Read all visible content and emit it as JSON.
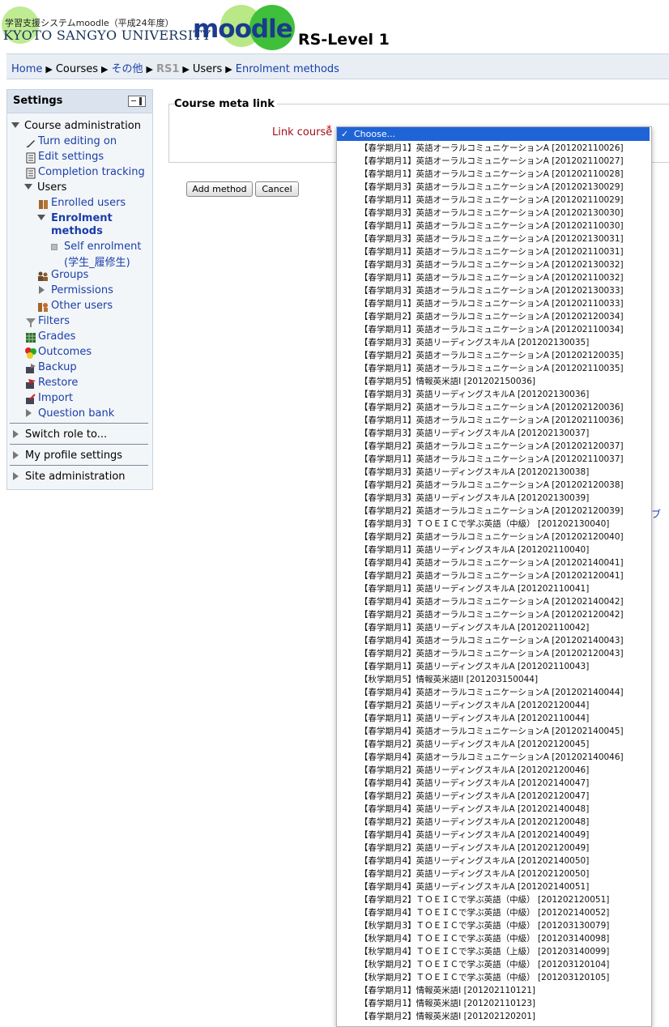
{
  "header": {
    "site_subtitle": "学習支援システムmoodle（平成24年度）",
    "site_university": "KYOTO SANGYO UNIVERSITY",
    "moodle_logo": "moodle",
    "course_title": "RS-Level 1"
  },
  "breadcrumb": {
    "home": "Home",
    "courses": "Courses",
    "other": "その他",
    "course": "RS1",
    "users": "Users",
    "current": "Enrolment methods",
    "separator": "▶"
  },
  "settings": {
    "title": "Settings",
    "course_admin": "Course administration",
    "turn_editing": "Turn editing on",
    "edit_settings": "Edit settings",
    "completion": "Completion tracking",
    "users": "Users",
    "enrolled_users": "Enrolled users",
    "enrolment_methods_1": "Enrolment",
    "enrolment_methods_2": "methods",
    "self_enrol_1": "Self enrolment",
    "self_enrol_2": "(学生_履修生)",
    "groups": "Groups",
    "permissions": "Permissions",
    "other_users": "Other users",
    "filters": "Filters",
    "grades": "Grades",
    "outcomes": "Outcomes",
    "backup": "Backup",
    "restore": "Restore",
    "import": "Import",
    "question_bank": "Question bank",
    "switch_role": "Switch role to...",
    "my_profile": "My profile settings",
    "site_admin": "Site administration"
  },
  "form": {
    "legend": "Course meta link",
    "label": "Link course",
    "required_mark": "*",
    "add_button": "Add method",
    "cancel_button": "Cancel",
    "stray": "ブ"
  },
  "dropdown": {
    "selected": "Choose...",
    "check": "✓",
    "options": [
      "【春学期月1】英語オーラルコミュニケーションA [201202110026]",
      "【春学期月1】英語オーラルコミュニケーションA [201202110027]",
      "【春学期月1】英語オーラルコミュニケーションA [201202110028]",
      "【春学期月3】英語オーラルコミュニケーションA [201202130029]",
      "【春学期月1】英語オーラルコミュニケーションA [201202110029]",
      "【春学期月3】英語オーラルコミュニケーションA [201202130030]",
      "【春学期月1】英語オーラルコミュニケーションA [201202110030]",
      "【春学期月3】英語オーラルコミュニケーションA [201202130031]",
      "【春学期月1】英語オーラルコミュニケーションA [201202110031]",
      "【春学期月3】英語オーラルコミュニケーションA [201202130032]",
      "【春学期月1】英語オーラルコミュニケーションA [201202110032]",
      "【春学期月3】英語オーラルコミュニケーションA [201202130033]",
      "【春学期月1】英語オーラルコミュニケーションA [201202110033]",
      "【春学期月2】英語オーラルコミュニケーションA [201202120034]",
      "【春学期月1】英語オーラルコミュニケーションA [201202110034]",
      "【春学期月3】英語リーディングスキルA [201202130035]",
      "【春学期月2】英語オーラルコミュニケーションA [201202120035]",
      "【春学期月1】英語オーラルコミュニケーションA [201202110035]",
      "【春学期月5】情報英米語I [201202150036]",
      "【春学期月3】英語リーディングスキルA [201202130036]",
      "【春学期月2】英語オーラルコミュニケーションA [201202120036]",
      "【春学期月1】英語オーラルコミュニケーションA [201202110036]",
      "【春学期月3】英語リーディングスキルA [201202130037]",
      "【春学期月2】英語オーラルコミュニケーションA [201202120037]",
      "【春学期月1】英語オーラルコミュニケーションA [201202110037]",
      "【春学期月3】英語リーディングスキルA [201202130038]",
      "【春学期月2】英語オーラルコミュニケーションA [201202120038]",
      "【春学期月3】英語リーディングスキルA [201202130039]",
      "【春学期月2】英語オーラルコミュニケーションA [201202120039]",
      "【春学期月3】ＴＯＥＩＣで学ぶ英語（中級） [201202130040]",
      "【春学期月2】英語オーラルコミュニケーションA [201202120040]",
      "【春学期月1】英語リーディングスキルA [201202110040]",
      "【春学期月4】英語オーラルコミュニケーションA [201202140041]",
      "【春学期月2】英語オーラルコミュニケーションA [201202120041]",
      "【春学期月1】英語リーディングスキルA [201202110041]",
      "【春学期月4】英語オーラルコミュニケーションA [201202140042]",
      "【春学期月2】英語オーラルコミュニケーションA [201202120042]",
      "【春学期月1】英語リーディングスキルA [201202110042]",
      "【春学期月4】英語オーラルコミュニケーションA [201202140043]",
      "【春学期月2】英語オーラルコミュニケーションA [201202120043]",
      "【春学期月1】英語リーディングスキルA [201202110043]",
      "【秋学期月5】情報英米語II [201203150044]",
      "【春学期月4】英語オーラルコミュニケーションA [201202140044]",
      "【春学期月2】英語リーディングスキルA [201202120044]",
      "【春学期月1】英語リーディングスキルA [201202110044]",
      "【春学期月4】英語オーラルコミュニケーションA [201202140045]",
      "【春学期月2】英語リーディングスキルA [201202120045]",
      "【春学期月4】英語オーラルコミュニケーションA [201202140046]",
      "【春学期月2】英語リーディングスキルA [201202120046]",
      "【春学期月4】英語リーディングスキルA [201202140047]",
      "【春学期月2】英語リーディングスキルA [201202120047]",
      "【春学期月4】英語リーディングスキルA [201202140048]",
      "【春学期月2】英語リーディングスキルA [201202120048]",
      "【春学期月4】英語リーディングスキルA [201202140049]",
      "【春学期月2】英語リーディングスキルA [201202120049]",
      "【春学期月4】英語リーディングスキルA [201202140050]",
      "【春学期月2】英語リーディングスキルA [201202120050]",
      "【春学期月4】英語リーディングスキルA [201202140051]",
      "【春学期月2】ＴＯＥＩＣで学ぶ英語（中級） [201202120051]",
      "【春学期月4】ＴＯＥＩＣで学ぶ英語（中級） [201202140052]",
      "【秋学期月3】ＴＯＥＩＣで学ぶ英語（中級） [201203130079]",
      "【秋学期月4】ＴＯＥＩＣで学ぶ英語（中級） [201203140098]",
      "【秋学期月4】ＴＯＥＩＣで学ぶ英語（上級） [201203140099]",
      "【秋学期月2】ＴＯＥＩＣで学ぶ英語（中級） [201203120104]",
      "【秋学期月2】ＴＯＥＩＣで学ぶ英語（中級） [201203120105]",
      "【春学期月1】情報英米語I [201202110121]",
      "【春学期月1】情報英米語I [201202110123]",
      "【春学期月2】情報英米語I [201202120201]"
    ]
  }
}
